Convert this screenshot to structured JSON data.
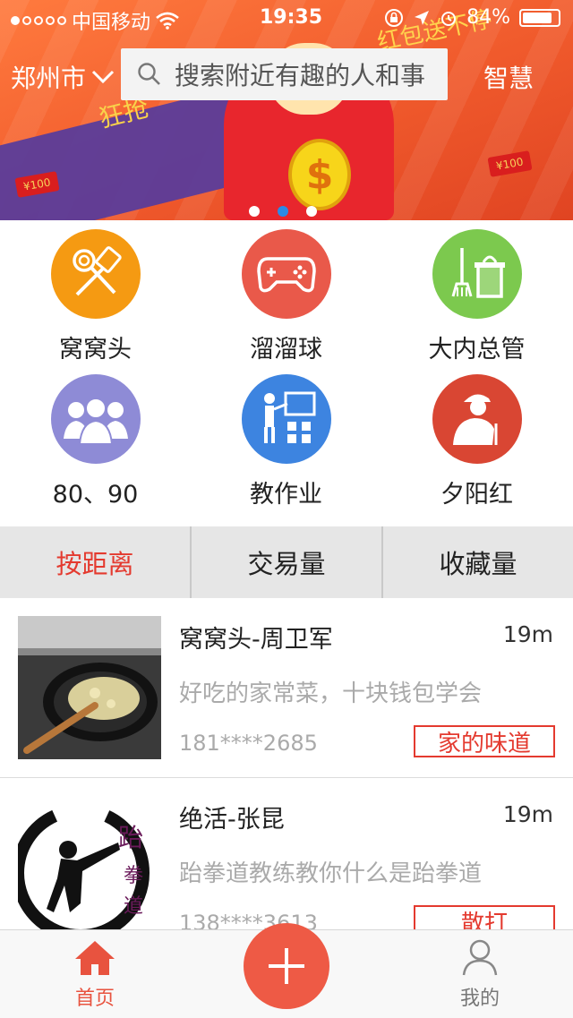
{
  "status_bar": {
    "signal_dots": [
      true,
      false,
      false,
      false,
      false
    ],
    "carrier": "中国移动",
    "time": "19:35",
    "battery": "84%",
    "battery_level": 0.84
  },
  "banner": {
    "slogan": "红包送不停",
    "purple_text": "狂抢",
    "redpack_1": "¥100",
    "redpack_2": "¥100",
    "page_count": 3,
    "active_page": 1
  },
  "header": {
    "city": "郑州市",
    "search_placeholder": "搜索附近有趣的人和事",
    "right_label": "智慧"
  },
  "categories": [
    {
      "label": "窝窝头",
      "color": "#f59a12",
      "icon": "cooking-tools-icon"
    },
    {
      "label": "溜溜球",
      "color": "#e9594a",
      "icon": "gamepad-icon"
    },
    {
      "label": "大内总管",
      "color": "#7cc94e",
      "icon": "cleaning-icon"
    },
    {
      "label": "80、90",
      "color": "#8e8bd6",
      "icon": "people-group-icon"
    },
    {
      "label": "教作业",
      "color": "#3d84e0",
      "icon": "teacher-icon"
    },
    {
      "label": "夕阳红",
      "color": "#d94633",
      "icon": "elder-icon"
    }
  ],
  "sort_tabs": [
    {
      "label": "按距离",
      "active": true
    },
    {
      "label": "交易量",
      "active": false
    },
    {
      "label": "收藏量",
      "active": false
    }
  ],
  "listings": [
    {
      "title": "窝窝头-周卫军",
      "distance": "19m",
      "desc": "好吃的家常菜，十块钱包学会",
      "phone": "181****2685",
      "tag": "家的味道",
      "thumb": "fried-rice-photo"
    },
    {
      "title": "绝活-张昆",
      "distance": "19m",
      "desc": "跆拳道教练教你什么是跆拳道",
      "phone": "138****3613",
      "tag": "散打",
      "thumb": "taekwondo-logo"
    }
  ],
  "tabbar": {
    "home_label": "首页",
    "me_label": "我的"
  },
  "colors": {
    "accent": "#e43a2f",
    "plus_button": "#ee5a45"
  }
}
